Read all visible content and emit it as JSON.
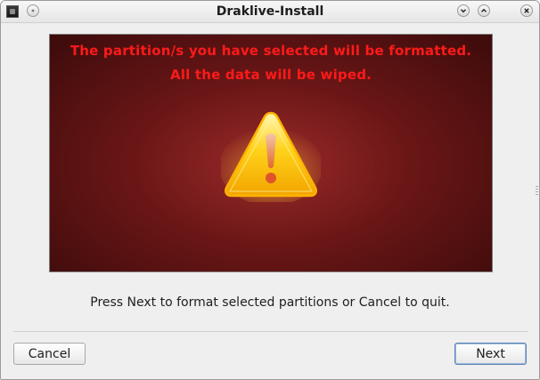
{
  "window": {
    "title": "Draklive-Install"
  },
  "titlebar": {
    "app_icon": "draklive-app-icon",
    "menu_button_icon": "window-menu-icon",
    "minimize_icon": "chevron-down-icon",
    "maximize_icon": "chevron-up-icon",
    "close_icon": "close-icon"
  },
  "banner": {
    "line1": "The partition/s you have selected will be formatted.",
    "line2": "All the data will be wiped.",
    "icon": "warning-triangle-icon",
    "text_color": "#ff1a1a"
  },
  "info_text": "Press Next to format selected partitions or Cancel to quit.",
  "buttons": {
    "cancel_label": "Cancel",
    "next_label": "Next"
  }
}
